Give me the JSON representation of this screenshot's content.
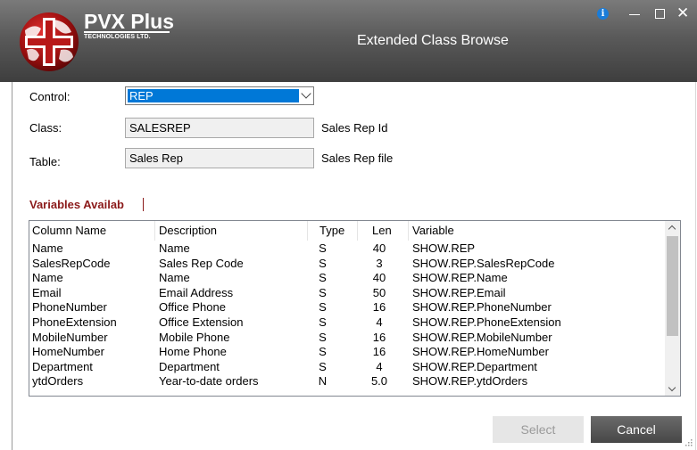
{
  "titlebar": {
    "brand_name": "PVX Plus",
    "brand_sub": "TECHNOLOGIES LTD.",
    "window_title": "Extended Class Browse",
    "info_glyph": "i",
    "close_glyph": "✕"
  },
  "form": {
    "control_label": "Control:",
    "control_value": "REP",
    "class_label": "Class:",
    "class_value": "SALESREP",
    "class_desc": "Sales Rep Id",
    "table_label": "Table:",
    "table_value": "Sales Rep",
    "table_desc": "Sales Rep file"
  },
  "variables": {
    "section_title": "Variables Availab",
    "columns": [
      "Column Name",
      "Description",
      "Type",
      "Len",
      "Variable"
    ],
    "rows": [
      {
        "col": "Name",
        "desc": "Name",
        "type": "S",
        "len": "40",
        "var": "SHOW.REP"
      },
      {
        "col": "SalesRepCode",
        "desc": "Sales Rep Code",
        "type": "S",
        "len": "3",
        "var": "SHOW.REP.SalesRepCode"
      },
      {
        "col": "Name",
        "desc": "Name",
        "type": "S",
        "len": "40",
        "var": "SHOW.REP.Name"
      },
      {
        "col": "Email",
        "desc": "Email Address",
        "type": "S",
        "len": "50",
        "var": "SHOW.REP.Email"
      },
      {
        "col": "PhoneNumber",
        "desc": "Office Phone",
        "type": "S",
        "len": "16",
        "var": "SHOW.REP.PhoneNumber"
      },
      {
        "col": "PhoneExtension",
        "desc": "Office Extension",
        "type": "S",
        "len": "4",
        "var": "SHOW.REP.PhoneExtension"
      },
      {
        "col": "MobileNumber",
        "desc": "Mobile Phone",
        "type": "S",
        "len": "16",
        "var": "SHOW.REP.MobileNumber"
      },
      {
        "col": "HomeNumber",
        "desc": "Home Phone",
        "type": "S",
        "len": "16",
        "var": "SHOW.REP.HomeNumber"
      },
      {
        "col": "Department",
        "desc": "Department",
        "type": "S",
        "len": "4",
        "var": "SHOW.REP.Department"
      },
      {
        "col": "ytdOrders",
        "desc": "Year-to-date orders",
        "type": "N",
        "len": "5.0",
        "var": "SHOW.REP.ytdOrders"
      }
    ]
  },
  "buttons": {
    "select_label": "Select",
    "cancel_label": "Cancel"
  },
  "colors": {
    "accent": "#0078d7",
    "section_title": "#8b1a1a",
    "info_icon": "#1a7cd8"
  }
}
